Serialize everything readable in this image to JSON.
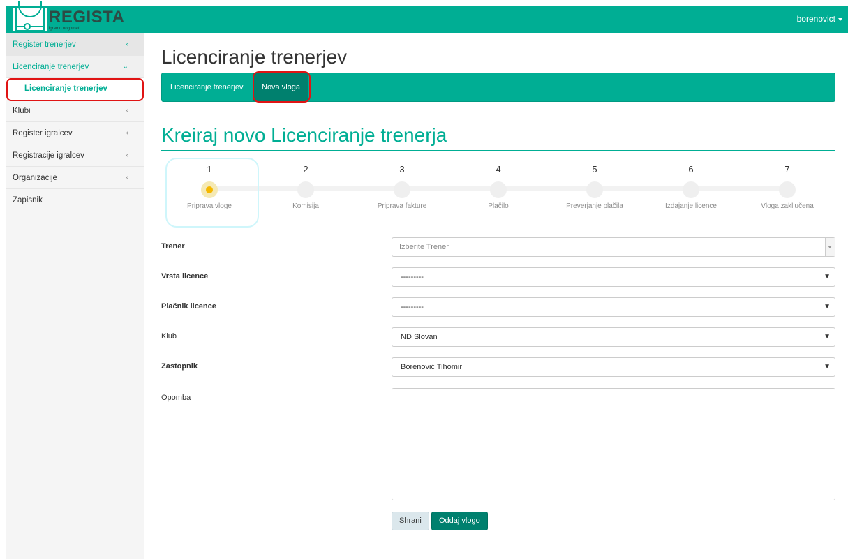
{
  "header": {
    "logo_text": "REGISTA",
    "logo_sub": "igramo nogomet!",
    "user": "borenovict",
    "color": "#00ae94"
  },
  "sidebar": {
    "items": [
      {
        "label": "Register trenerjev",
        "chevron": "‹"
      },
      {
        "label": "Licenciranje trenerjev",
        "chevron": "⌄"
      },
      {
        "label": "Licenciranje trenerjev"
      },
      {
        "label": "Klubi",
        "chevron": "‹"
      },
      {
        "label": "Register igralcev",
        "chevron": "‹"
      },
      {
        "label": "Registracije igralcev",
        "chevron": "‹"
      },
      {
        "label": "Organizacije",
        "chevron": "‹"
      },
      {
        "label": "Zapisnik"
      }
    ]
  },
  "main": {
    "title": "Licenciranje trenerjev",
    "tabs": [
      {
        "label": "Licenciranje trenerjev"
      },
      {
        "label": "Nova vloga"
      }
    ],
    "form_title": "Kreiraj novo Licenciranje trenerja"
  },
  "steps": [
    {
      "num": "1",
      "label": "Priprava vloge"
    },
    {
      "num": "2",
      "label": "Komisija"
    },
    {
      "num": "3",
      "label": "Priprava fakture"
    },
    {
      "num": "4",
      "label": "Plačilo"
    },
    {
      "num": "5",
      "label": "Preverjanje plačila"
    },
    {
      "num": "6",
      "label": "Izdajanje licence"
    },
    {
      "num": "7",
      "label": "Vloga zaključena"
    }
  ],
  "form": {
    "trener": {
      "label": "Trener",
      "placeholder": "Izberite Trener"
    },
    "vrsta": {
      "label": "Vrsta licence",
      "value": "---------"
    },
    "placnik": {
      "label": "Plačnik licence",
      "value": "---------"
    },
    "klub": {
      "label": "Klub",
      "value": "ND Slovan"
    },
    "zastopnik": {
      "label": "Zastopnik",
      "value": "Borenović Tihomir"
    },
    "opomba": {
      "label": "Opomba",
      "value": ""
    },
    "save_label": "Shrani",
    "submit_label": "Oddaj vlogo"
  }
}
